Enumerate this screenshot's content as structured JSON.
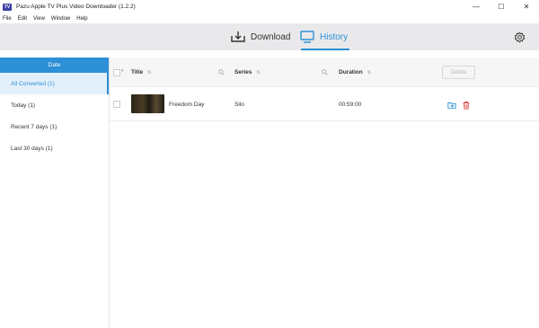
{
  "window": {
    "title": "Pazu Apple TV Plus Video Downloader (1.2.2)",
    "logo_text": "TV",
    "controls": {
      "minimize": "—",
      "maximize": "☐",
      "close": "✕"
    }
  },
  "menu": [
    "File",
    "Edit",
    "View",
    "Window",
    "Help"
  ],
  "header": {
    "tabs": [
      {
        "label": "Download",
        "icon": "download-icon",
        "active": false
      },
      {
        "label": "History",
        "icon": "monitor-icon",
        "active": true
      }
    ],
    "settings_icon": "gear-icon"
  },
  "sidebar": {
    "header": "Date",
    "items": [
      {
        "label": "All Converted (1)",
        "active": true
      },
      {
        "label": "Today (1)",
        "active": false
      },
      {
        "label": "Recent 7 days (1)",
        "active": false
      },
      {
        "label": "Last 30 days (1)",
        "active": false
      }
    ]
  },
  "table": {
    "columns": {
      "title": "Title",
      "series": "Series",
      "duration": "Duration"
    },
    "delete_label": "Delete",
    "rows": [
      {
        "title": "Freedom Day",
        "series": "Silo",
        "duration": "00:59:00"
      }
    ]
  },
  "colors": {
    "accent": "#2d8fd6",
    "delete_icon": "#e04848",
    "header_bg": "#e9e9eb"
  }
}
